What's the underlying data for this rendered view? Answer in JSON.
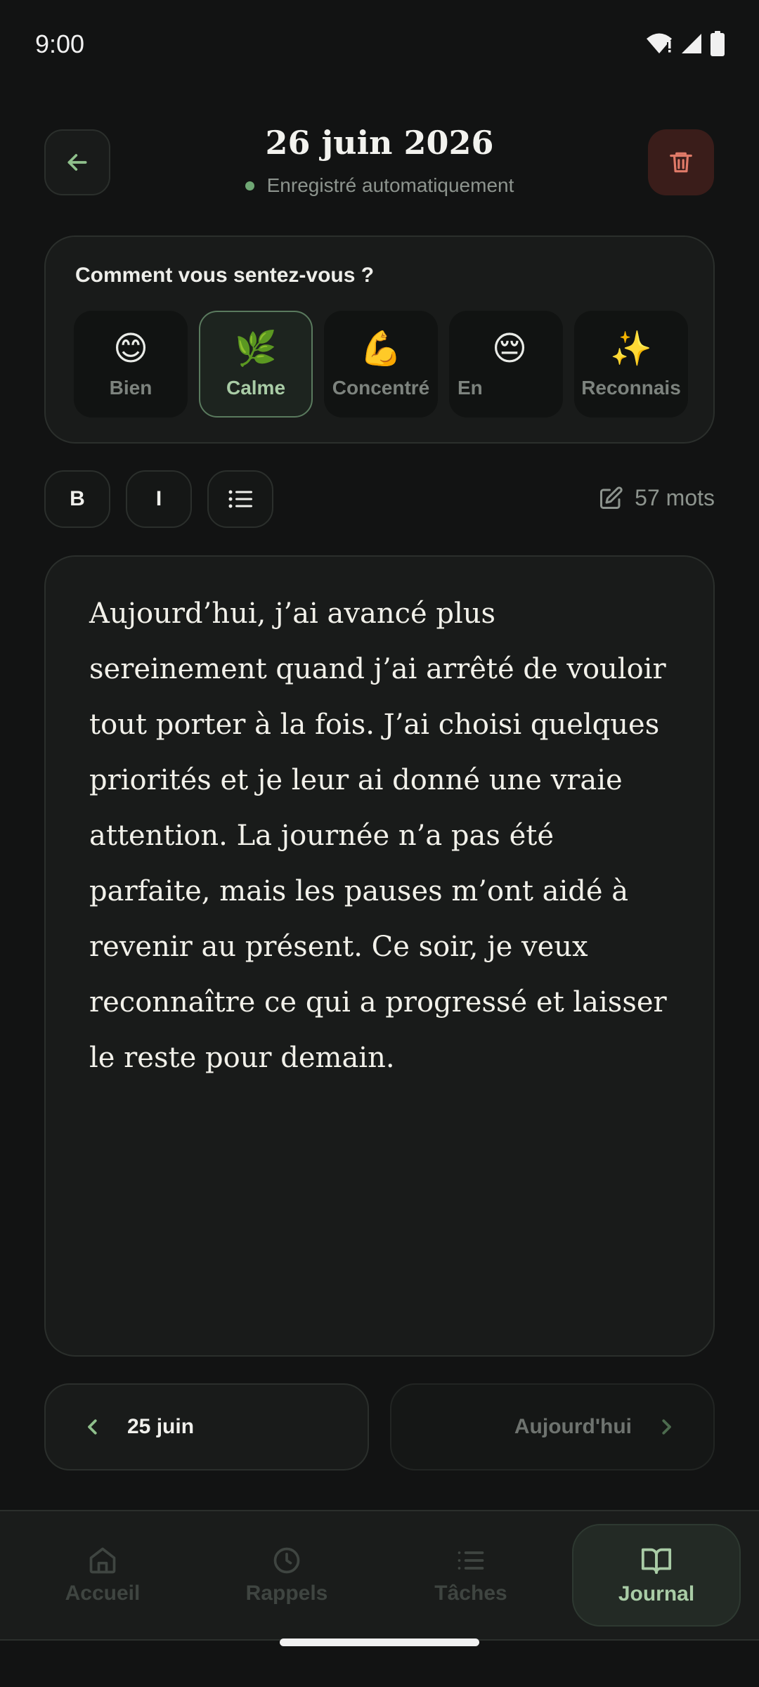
{
  "status_bar": {
    "time": "9:00"
  },
  "header": {
    "title": "26 juin 2026",
    "autosave_text": "Enregistré automatiquement"
  },
  "mood": {
    "question": "Comment vous sentez-vous ?",
    "items": [
      {
        "emoji": "😊",
        "label": "Bien",
        "selected": false
      },
      {
        "emoji": "🌿",
        "label": "Calme",
        "selected": true
      },
      {
        "emoji": "💪",
        "label": "Concentré",
        "selected": false
      },
      {
        "emoji": "😔",
        "label": "En",
        "selected": false
      },
      {
        "emoji": "✨",
        "label": "Reconnais",
        "selected": false
      }
    ]
  },
  "toolbar": {
    "bold_label": "B",
    "italic_label": "I",
    "word_count": "57 mots"
  },
  "editor": {
    "text": "Aujourd’hui, j’ai avancé plus sereinement quand j’ai arrêté de vouloir tout porter à la fois. J’ai choisi quelques priorités et je leur ai donné une vraie attention. La journée n’a pas été parfaite, mais les pauses m’ont aidé à revenir au présent. Ce soir, je veux reconnaître ce qui a progressé et laisser le reste pour demain."
  },
  "day_nav": {
    "prev_label": "25 juin",
    "next_label": "Aujourd'hui"
  },
  "bottom_nav": {
    "items": [
      {
        "label": "Accueil",
        "icon": "home-icon",
        "active": false
      },
      {
        "label": "Rappels",
        "icon": "clock-icon",
        "active": false
      },
      {
        "label": "Tâches",
        "icon": "list-icon",
        "active": false
      },
      {
        "label": "Journal",
        "icon": "book-icon",
        "active": true
      }
    ]
  },
  "colors": {
    "background": "#121313",
    "card": "#191b1a",
    "accent": "#a9cca6",
    "autosave_dot": "#6fa774",
    "delete_bg": "#3a1d1a",
    "delete_icon": "#e07a68"
  }
}
